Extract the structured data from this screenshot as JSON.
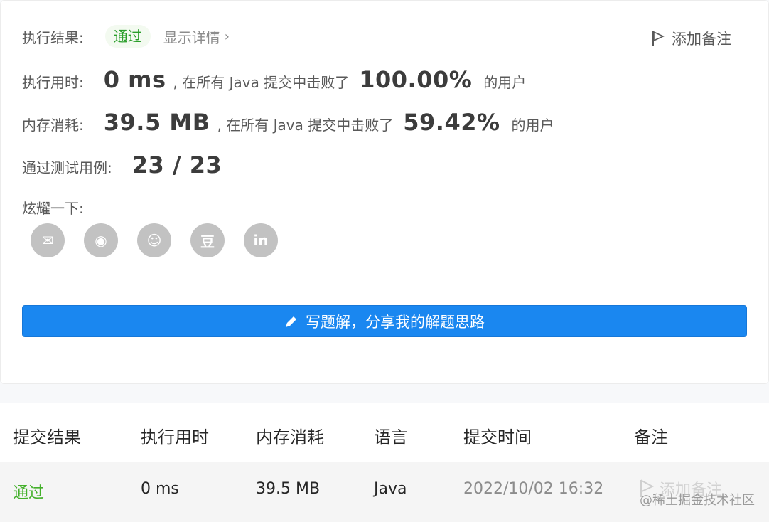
{
  "result": {
    "label": "执行结果:",
    "status": "通过",
    "details": "显示详情",
    "add_note": "添加备注"
  },
  "runtime": {
    "label": "执行用时:",
    "value": "0 ms",
    "beat_text": ", 在所有 Java 提交中击败了",
    "percent": "100.00%",
    "suffix": "的用户"
  },
  "memory": {
    "label": "内存消耗:",
    "value": "39.5 MB",
    "beat_text": ", 在所有 Java 提交中击败了",
    "percent": "59.42%",
    "suffix": "的用户"
  },
  "tests": {
    "label": "通过测试用例:",
    "value": "23 / 23"
  },
  "share": {
    "label": "炫耀一下:",
    "items": [
      {
        "icon": "wechat-icon",
        "glyph": "✉"
      },
      {
        "icon": "weibo-icon",
        "glyph": "◉"
      },
      {
        "icon": "qq-icon",
        "glyph": "☺"
      },
      {
        "icon": "douban-icon",
        "glyph": "豆"
      },
      {
        "icon": "linkedin-icon",
        "glyph": "in"
      }
    ]
  },
  "write_button": {
    "label": "写题解，分享我的解题思路"
  },
  "table": {
    "headers": [
      "提交结果",
      "执行用时",
      "内存消耗",
      "语言",
      "提交时间",
      "备注"
    ],
    "rows": [
      {
        "status": "通过",
        "runtime": "0 ms",
        "memory": "39.5 MB",
        "language": "Java",
        "time": "2022/10/02 16:32",
        "note": "添加备注"
      }
    ]
  },
  "watermark": "@稀土掘金技术社区",
  "colors": {
    "pass_green": "#43b02a",
    "primary_blue": "#1a87f0",
    "share_gray": "#c2c2c2"
  }
}
